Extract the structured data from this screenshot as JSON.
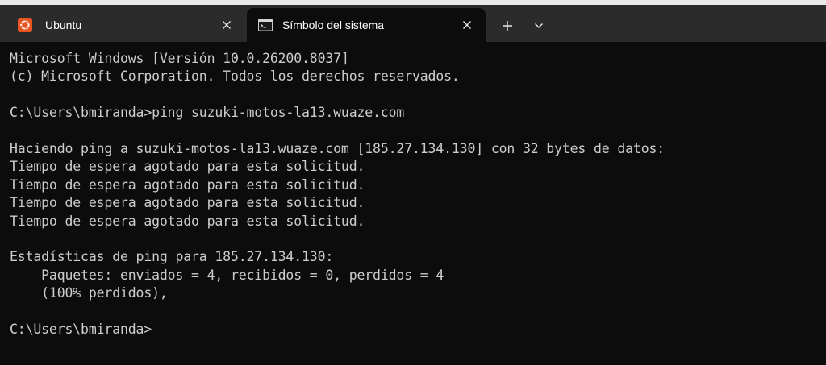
{
  "tabs": [
    {
      "label": "Ubuntu",
      "icon": "ubuntu-icon",
      "active": false
    },
    {
      "label": "Símbolo del sistema",
      "icon": "command-prompt-icon",
      "active": true
    }
  ],
  "toolbar": {
    "new_tab_icon": "plus-icon",
    "dropdown_icon": "chevron-down-icon"
  },
  "colors": {
    "titlebar": "#2b2b2b",
    "terminal_bg": "#0c0c0c",
    "terminal_fg": "#cccccc",
    "ubuntu_orange": "#e95420"
  },
  "terminal": {
    "lines": [
      "Microsoft Windows [Versión 10.0.26200.8037]",
      "(c) Microsoft Corporation. Todos los derechos reservados.",
      "",
      "C:\\Users\\bmiranda>ping suzuki-motos-la13.wuaze.com",
      "",
      "Haciendo ping a suzuki-motos-la13.wuaze.com [185.27.134.130] con 32 bytes de datos:",
      "Tiempo de espera agotado para esta solicitud.",
      "Tiempo de espera agotado para esta solicitud.",
      "Tiempo de espera agotado para esta solicitud.",
      "Tiempo de espera agotado para esta solicitud.",
      "",
      "Estadísticas de ping para 185.27.134.130:",
      "    Paquetes: enviados = 4, recibidos = 0, perdidos = 4",
      "    (100% perdidos),",
      "",
      "C:\\Users\\bmiranda>"
    ]
  }
}
